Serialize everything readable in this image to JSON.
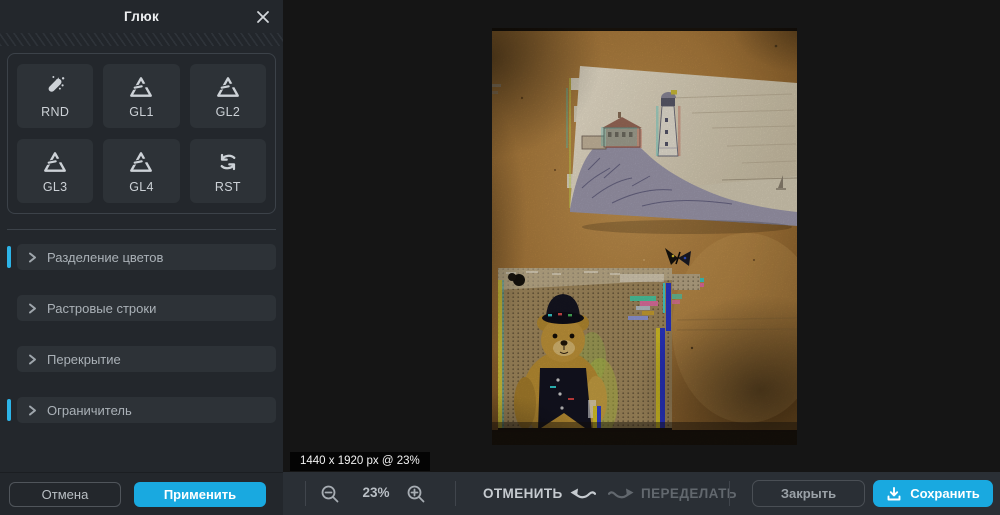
{
  "panel": {
    "title": "Глюк",
    "presets": [
      {
        "label": "RND",
        "icon": "magic-wand-icon"
      },
      {
        "label": "GL1",
        "icon": "glitch-triangle-icon"
      },
      {
        "label": "GL2",
        "icon": "glitch-triangle-icon"
      },
      {
        "label": "GL3",
        "icon": "glitch-triangle-icon"
      },
      {
        "label": "GL4",
        "icon": "glitch-triangle-icon"
      },
      {
        "label": "RST",
        "icon": "reset-cycle-icon"
      }
    ],
    "sections": [
      {
        "label": "Разделение цветов",
        "active": true
      },
      {
        "label": "Растровые строки",
        "active": false
      },
      {
        "label": "Перекрытие",
        "active": false
      },
      {
        "label": "Ограничитель",
        "active": true
      }
    ],
    "cancel_label": "Отмена",
    "apply_label": "Применить"
  },
  "canvas": {
    "status_text": "1440 x 1920 px @ 23%"
  },
  "toolbar": {
    "zoom_level": "23%",
    "undo_label": "ОТМЕНИТЬ",
    "redo_label": "ПЕРЕДЕЛАТЬ",
    "close_label": "Закрыть",
    "save_label": "Сохранить"
  },
  "colors": {
    "accent": "#19a9e0",
    "section_indicator": "#2db4e8",
    "panel_bg": "#23272c",
    "tile_bg": "#2d3237"
  }
}
